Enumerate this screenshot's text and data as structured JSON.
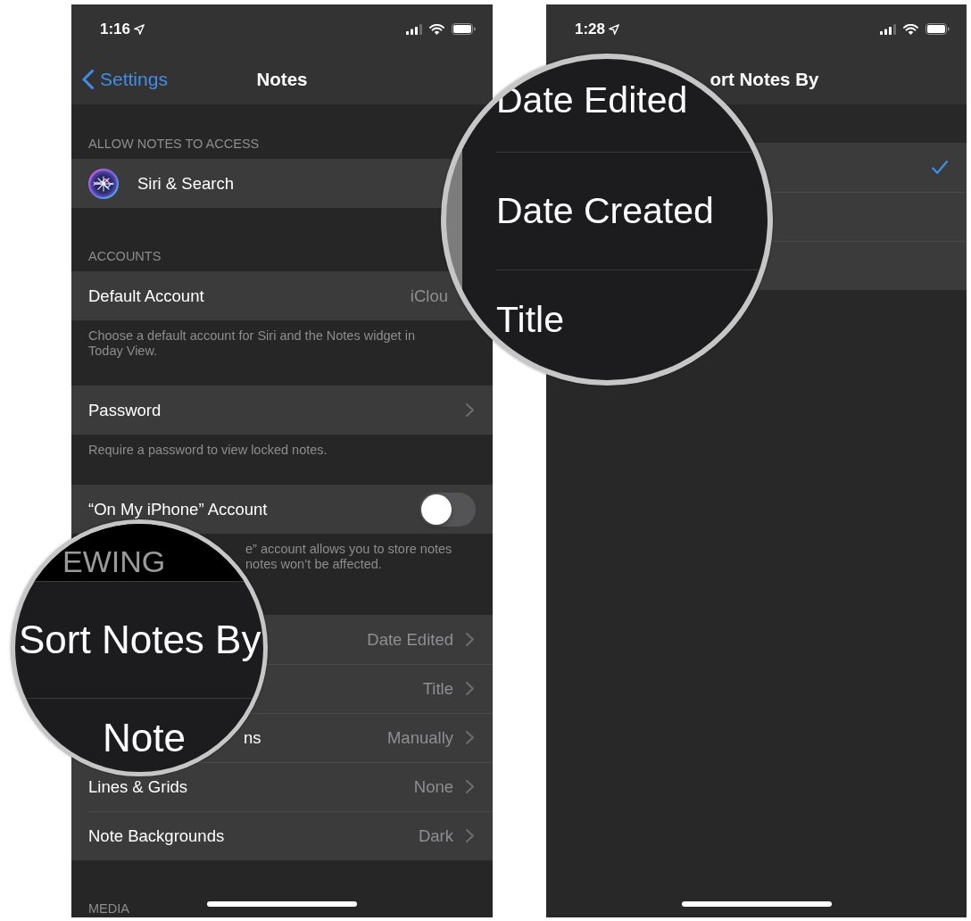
{
  "screens": [
    {
      "status_bar": {
        "time": "1:16"
      },
      "nav_bar": {
        "back": "Settings",
        "title": "Notes"
      },
      "sections": [
        {
          "header": "ALLOW NOTES TO ACCESS",
          "rows": [
            {
              "kind": "icon",
              "label": "Siri & Search"
            }
          ]
        },
        {
          "header": "ACCOUNTS",
          "rows": [
            {
              "kind": "value",
              "label": "Default Account",
              "value": "iClou"
            }
          ],
          "footer": {
            "kind": "note",
            "lines": [
              "Choose a default account for Siri and the Notes widget in Today View."
            ]
          }
        },
        {
          "rows": [
            {
              "kind": "link",
              "label": "Password"
            }
          ],
          "footer": {
            "kind": "note",
            "lines": [
              "Require a password to view locked notes."
            ]
          }
        },
        {
          "rows": [
            {
              "kind": "toggle",
              "label": "“On My iPhone” Account",
              "on": false
            }
          ],
          "footer": {
            "kind": "partial",
            "lines": [
              "e” account allows you to store notes",
              "notes won’t be affected."
            ]
          }
        },
        {
          "rows": [
            {
              "kind": "link",
              "value": "Date Edited"
            },
            {
              "kind": "link",
              "value": "Title"
            },
            {
              "kind": "partial",
              "label": "ns",
              "value": "Manually"
            },
            {
              "kind": "link",
              "label": "Lines & Grids",
              "value": "None"
            },
            {
              "kind": "link",
              "label": "Note Backgrounds",
              "value": "Dark"
            }
          ]
        },
        {
          "header": "MEDIA"
        }
      ],
      "magnifier": {
        "header": "EWING",
        "labels": [
          "Sort Notes By",
          "Note"
        ]
      }
    },
    {
      "status_bar": {
        "time": "1:28"
      },
      "nav_bar": {
        "title": "ort Notes By"
      },
      "sections": [
        {
          "rows": [
            {
              "kind": "option",
              "selected": true
            },
            {
              "kind": "option",
              "selected": false
            },
            {
              "kind": "option",
              "selected": false
            }
          ]
        }
      ],
      "magnifier": {
        "labels": [
          "Date Edited",
          "Date Created",
          "Title"
        ]
      }
    }
  ]
}
